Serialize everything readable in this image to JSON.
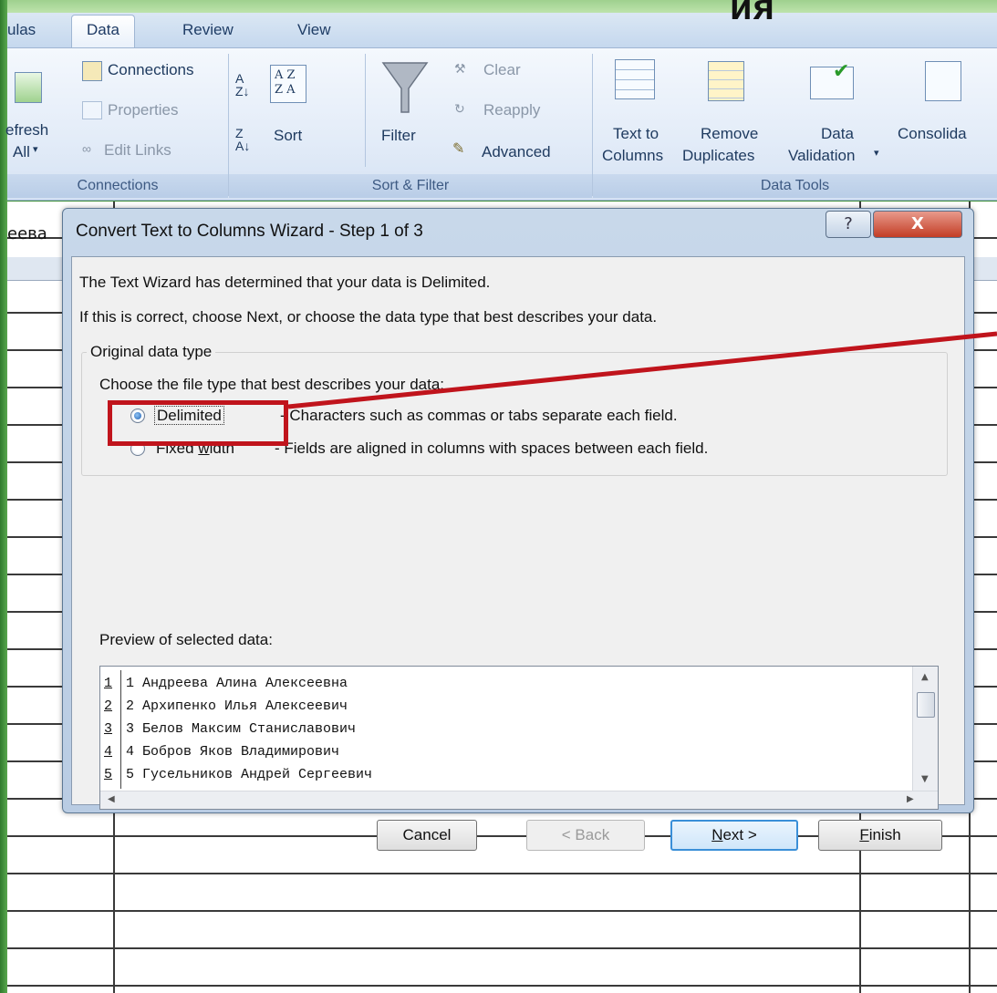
{
  "slide": {
    "title_fragment": "ия"
  },
  "ribbon": {
    "tabs": [
      "ulas",
      "Data",
      "Review",
      "View"
    ],
    "active_tab": "Data",
    "connections_group": {
      "label": "Connections",
      "refresh_top": "efresh",
      "refresh_bottom": "All",
      "connections": "Connections",
      "properties": "Properties",
      "edit_links": "Edit Links"
    },
    "sort_filter_group": {
      "label": "Sort & Filter",
      "sort": "Sort",
      "filter": "Filter",
      "clear": "Clear",
      "reapply": "Reapply",
      "advanced": "Advanced"
    },
    "data_tools_group": {
      "label": "Data Tools",
      "text_to_columns_1": "Text to",
      "text_to_columns_2": "Columns",
      "remove_dup_1": "Remove",
      "remove_dup_2": "Duplicates",
      "validation_1": "Data",
      "validation_2": "Validation",
      "consolidate": "Consolida"
    }
  },
  "sheet": {
    "namebox_text": "еева"
  },
  "dialog": {
    "title": "Convert Text to Columns Wizard - Step 1 of 3",
    "help": "?",
    "close": "X",
    "line1": "The Text Wizard has determined that your data is Delimited.",
    "line2": "If this is correct, choose Next, or choose the data type that best describes your data.",
    "group_title": "Original data type",
    "choose_label": "Choose the file type that best describes your data:",
    "options": [
      {
        "label": "Delimited",
        "desc": "- Characters such as commas or tabs separate each field.",
        "selected": true
      },
      {
        "label_pre": "Fixed ",
        "label_ul": "w",
        "label_post": "idth",
        "desc": "- Fields are aligned in columns with spaces between each field.",
        "selected": false
      }
    ],
    "preview_label": "Preview of selected data:",
    "preview_rows": [
      {
        "num": "1",
        "text": "1 Андреева Алина Алексеевна"
      },
      {
        "num": "2",
        "text": "2 Архипенко Илья Алексеевич"
      },
      {
        "num": "3",
        "text": "3 Белов Максим Станиславович"
      },
      {
        "num": "4",
        "text": "4 Бобров Яков Владимирович"
      },
      {
        "num": "5",
        "text": "5 Гусельников Андрей Сергеевич"
      }
    ],
    "buttons": {
      "cancel": "Cancel",
      "back": "< Back",
      "next": "Next >",
      "finish": "Finish"
    }
  },
  "colors": {
    "highlight": "#c0141c",
    "frame_green": "#3f8f3a",
    "ribbon_blue": "#dbe7f4"
  }
}
